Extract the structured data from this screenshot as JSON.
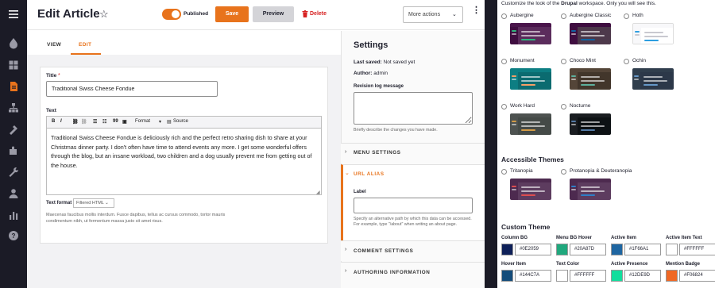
{
  "header": {
    "title": "Edit Article",
    "published_label": "Published",
    "save_label": "Save",
    "preview_label": "Preview",
    "delete_label": "Delete",
    "more_actions_label": "More actions"
  },
  "tabs": {
    "view": "VIEW",
    "edit": "EDIT"
  },
  "form": {
    "title_label": "Title",
    "title_required": "*",
    "title_value": "Traditional Swiss Cheese Fondue",
    "text_label": "Text",
    "toolbar": {
      "bold": "B",
      "italic": "I",
      "quote": "99",
      "format": "Format",
      "source": "Source"
    },
    "body_text": "Traditional Swiss Cheese Fondue is deliciously rich and the perfect retro sharing dish to share at your Christmas dinner party. I don't often have time to attend events any more. I get some wonderful offers through the blog, but an insane workload, two children and a dog usually prevent me from getting out of the house.",
    "text_format_label": "Text format",
    "text_format_value": "Filtered HTML",
    "format_help": "Maecenas faucibus mollis interdum. Fusce dapibus, tellus ac cursus commodo, tortor mauris condimentum nibh, ut fermentum massa justo sit amet risus."
  },
  "settings": {
    "title": "Settings",
    "last_saved_label": "Last saved:",
    "last_saved_value": "Not saved yet",
    "author_label": "Author:",
    "author_value": "admin",
    "revision_label": "Revision log message",
    "revision_help": "Briefly describe the changes you have made.",
    "menu_settings": "MENU SETTINGS",
    "url_alias": "URL ALIAS",
    "label_label": "Label",
    "label_help": "Specify an alternative path by which this data can be accessed. For example, type \"/about\" when writing an about page.",
    "comment_settings": "COMMENT SETTINGS",
    "authoring_information": "AUTHORING INFORMATION"
  },
  "themes": {
    "intro_prefix": "Customize the look of the",
    "intro_brand": "Drupal",
    "intro_suffix": "workspace. Only you will see this.",
    "items": [
      {
        "name": "Aubergine",
        "bar": "#4a154b",
        "side": "#3f0e40",
        "body": "#5b2c5c",
        "accent": "#2eb67d"
      },
      {
        "name": "Aubergine Classic",
        "bar": "#3f0e40",
        "side": "#3f0e40",
        "body": "#4d394b",
        "accent": "#1164a3"
      },
      {
        "name": "Hoth",
        "bar": "#f8f8fa",
        "side": "#f8f8fa",
        "body": "#ffffff",
        "accent": "#2d9ee0"
      },
      {
        "name": "Monument",
        "bar": "#0d7e83",
        "side": "#0d7e83",
        "body": "#0b6b70",
        "accent": "#f79f66"
      },
      {
        "name": "Choco Mint",
        "bar": "#544538",
        "side": "#544538",
        "body": "#42362b",
        "accent": "#5db09d"
      },
      {
        "name": "Ochin",
        "bar": "#303e4d",
        "side": "#303e4d",
        "body": "#2c3849",
        "accent": "#6698c8"
      },
      {
        "name": "Work Hard",
        "bar": "#4d5250",
        "side": "#4d5250",
        "body": "#444a47",
        "accent": "#d39b46"
      },
      {
        "name": "Nocturne",
        "bar": "#1a1d21",
        "side": "#1a1d21",
        "body": "#0d1114",
        "accent": "#537aa6"
      }
    ],
    "accessible_heading": "Accessible Themes",
    "accessible_items": [
      {
        "name": "Tritanopia",
        "bar": "#4d2a4f",
        "side": "#4d2a4f",
        "body": "#5d3c5f",
        "accent": "#de4e51"
      },
      {
        "name": "Protanopia & Deuteranopia",
        "bar": "#4d2a4f",
        "side": "#4d2a4f",
        "body": "#5d3c5f",
        "accent": "#2f7ec7"
      }
    ],
    "custom_heading": "Custom Theme",
    "custom": [
      {
        "label": "Column BG",
        "hex": "#0E2059"
      },
      {
        "label": "Menu BG Hover",
        "hex": "#20A87D"
      },
      {
        "label": "Active Item",
        "hex": "#1F66A1"
      },
      {
        "label": "Active Item Text",
        "hex": "#FFFFFF"
      },
      {
        "label": "Hover Item",
        "hex": "#144C7A"
      },
      {
        "label": "Text Color",
        "hex": "#FFFFFF"
      },
      {
        "label": "Active Presence",
        "hex": "#12DE9D"
      },
      {
        "label": "Mention Badge",
        "hex": "#F06824"
      }
    ]
  },
  "colors": {
    "accent": "#e8731c",
    "danger": "#d72222",
    "sidebar": "#1b1b26"
  }
}
